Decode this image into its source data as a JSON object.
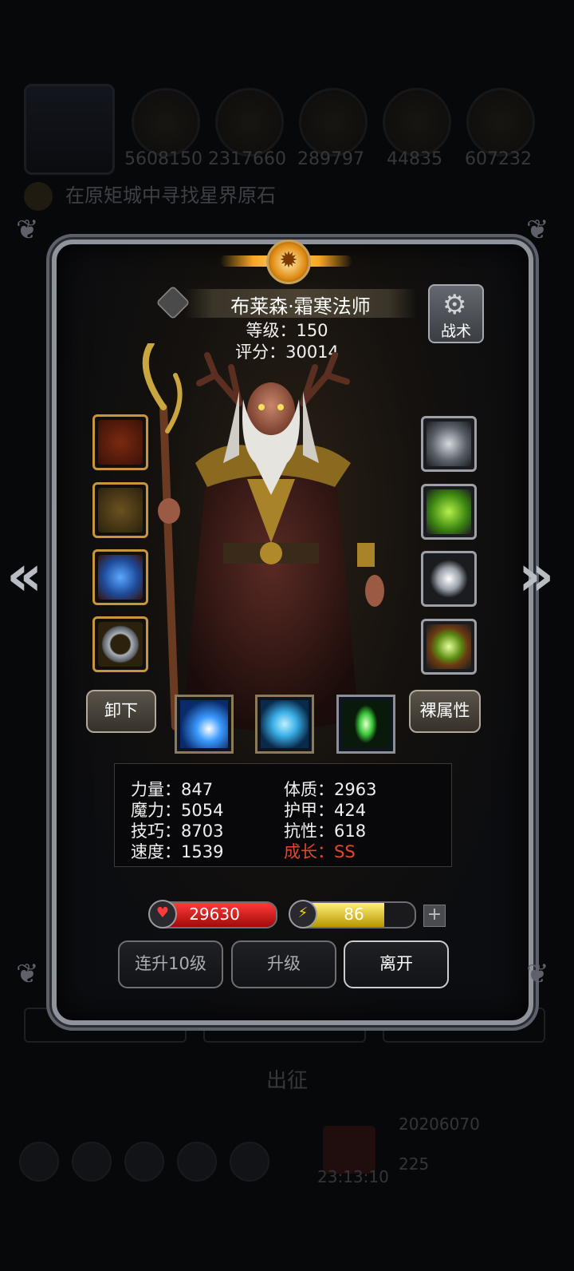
{
  "background": {
    "resources": [
      "5608150",
      "2317660",
      "289797",
      "44835",
      "607232"
    ],
    "quest_text": "在原矩城中寻找星界原石",
    "march_label": "出征",
    "time": "23:13:10",
    "coins": "20206070",
    "gems": "225"
  },
  "hero": {
    "name": "布莱森·霜寒法师",
    "level_label": "等级：150",
    "score_label": "评分：30014",
    "tactics_label": "战术"
  },
  "buttons": {
    "unequip": "卸下",
    "base_attributes": "裸属性",
    "level_up_10": "连升10级",
    "level_up": "升级",
    "leave": "离开"
  },
  "stats": {
    "strength": "力量：847",
    "constitution": "体质：2963",
    "magic": "魔力：5054",
    "armor": "护甲：424",
    "skill": "技巧：8703",
    "resistance": "抗性：618",
    "speed": "速度：1539",
    "growth": "成长：SS"
  },
  "bars": {
    "hp": "29630",
    "hp_fraction": 1.0,
    "energy": "86",
    "energy_fraction": 0.75
  },
  "icons": {
    "left_arrow": "chevron-left-icon",
    "right_arrow": "chevron-right-icon",
    "tactics": "gear-icon",
    "hp": "heart-icon",
    "energy": "lightning-icon"
  },
  "colors": {
    "growth": "#e0482a",
    "hp_bar": "#d01818",
    "energy_bar": "#e6c000"
  }
}
